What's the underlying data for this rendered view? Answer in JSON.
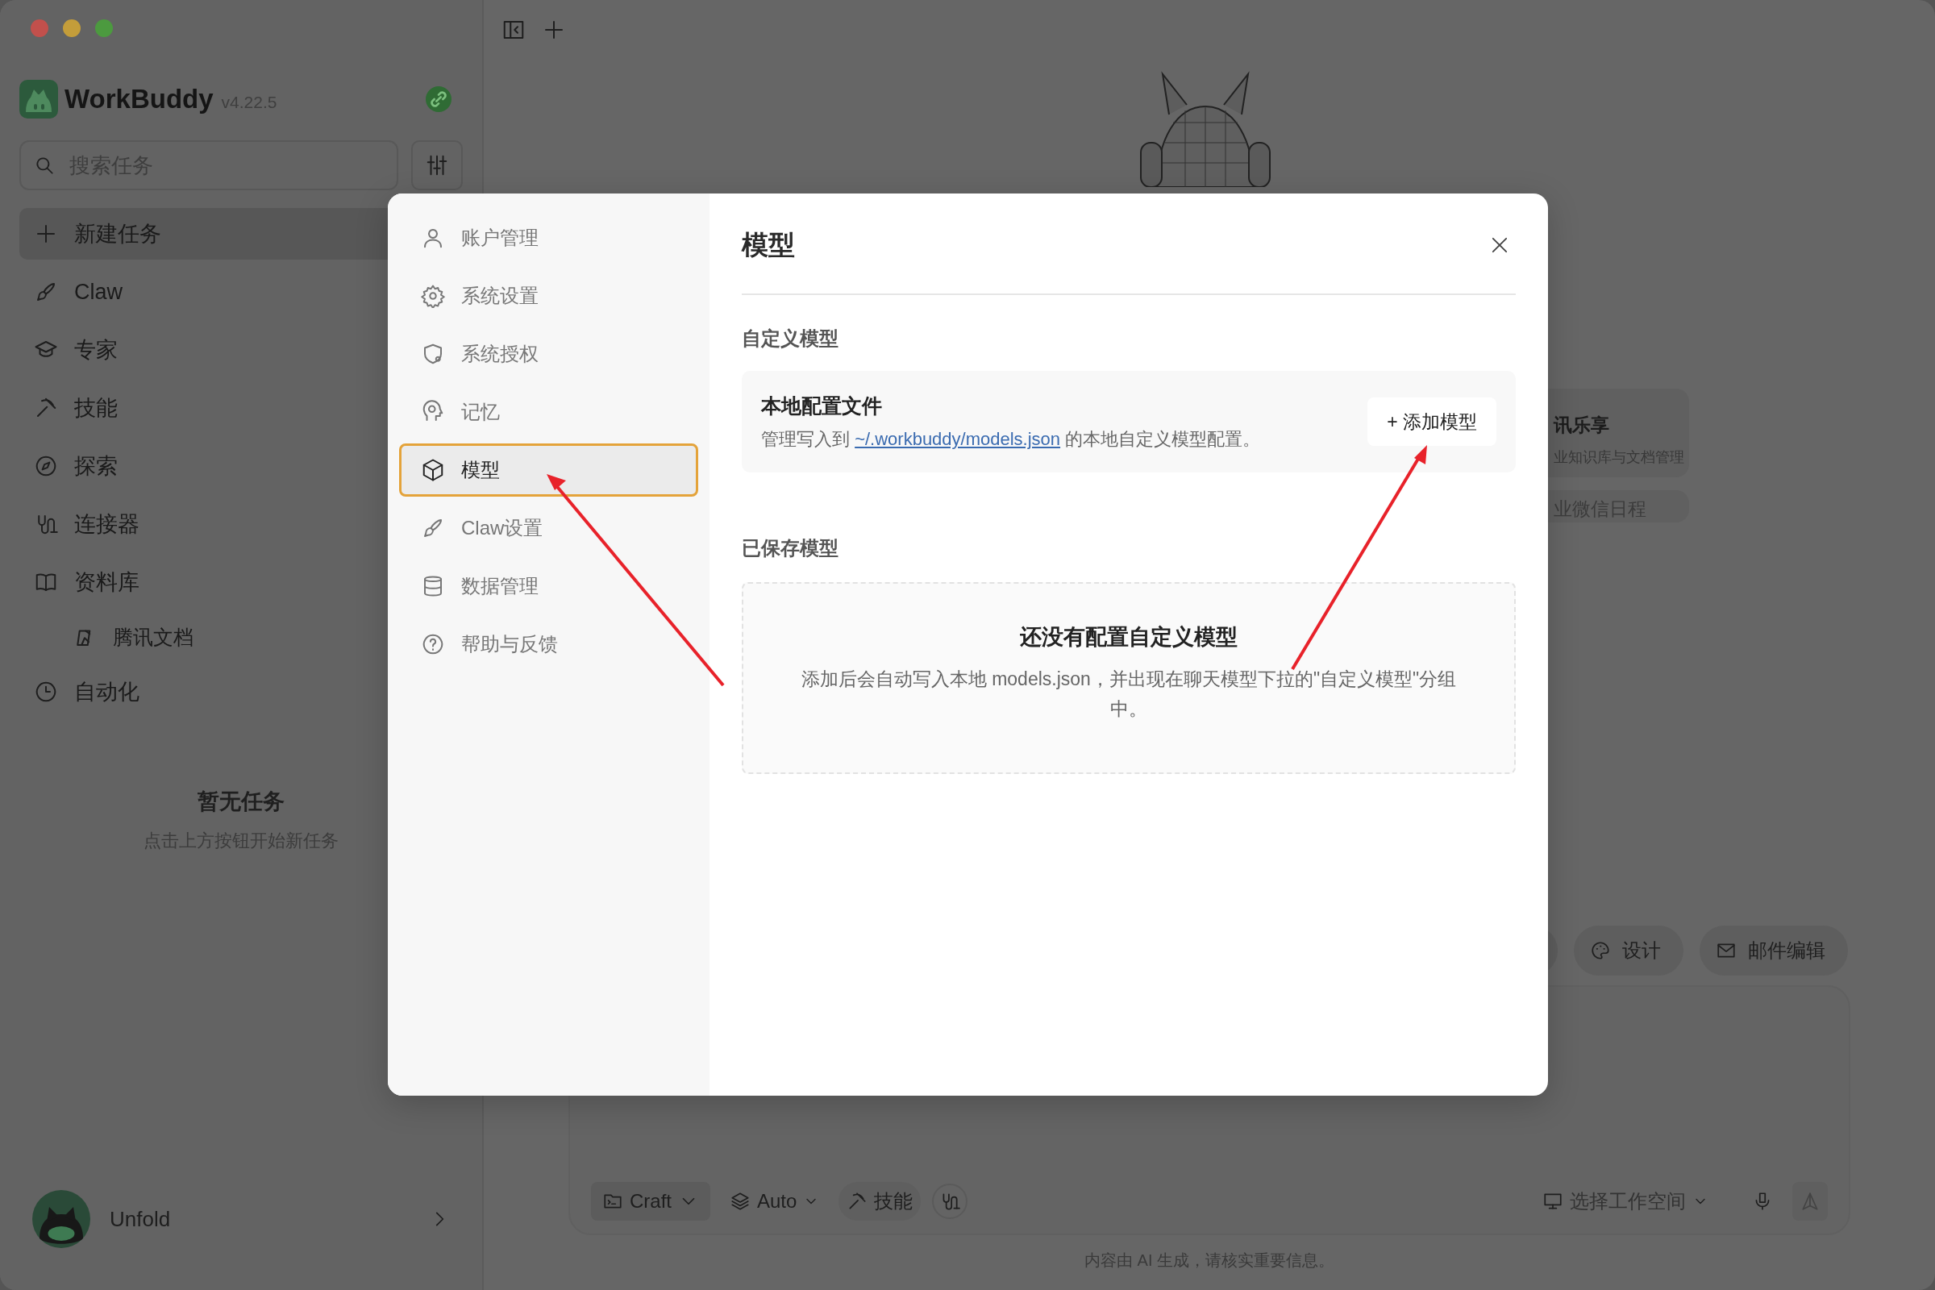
{
  "app": {
    "name": "WorkBuddy",
    "version": "v4.22.5"
  },
  "sidebar": {
    "search": {
      "placeholder": "搜索任务"
    },
    "items": [
      {
        "label": "新建任务",
        "selected": true
      },
      {
        "label": "Claw",
        "selected": false
      },
      {
        "label": "专家",
        "selected": false
      },
      {
        "label": "技能",
        "selected": false
      },
      {
        "label": "探索",
        "selected": false
      },
      {
        "label": "连接器",
        "selected": false
      },
      {
        "label": "资料库",
        "selected": false,
        "children": [
          {
            "label": "腾讯文档",
            "selected": false
          }
        ]
      },
      {
        "label": "自动化",
        "selected": false
      }
    ],
    "empty": {
      "title": "暂无任务",
      "hint": "点击上方按钮开始新任务"
    },
    "user": {
      "name": "Unfold"
    }
  },
  "main": {
    "quick_cards": [
      {
        "title": "讯乐享",
        "subtitle": "业知识库与文档管理"
      },
      {
        "title": "业微信日程"
      }
    ],
    "chips": [
      "设计",
      "邮件编辑"
    ],
    "composer": {
      "mode": "Craft",
      "model": "Auto",
      "skills": "技能",
      "workspace": "选择工作空间"
    },
    "disclaimer": "内容由 AI 生成，请核实重要信息。"
  },
  "dialog": {
    "nav": [
      {
        "label": "账户管理",
        "selected": false
      },
      {
        "label": "系统设置",
        "selected": false
      },
      {
        "label": "系统授权",
        "selected": false
      },
      {
        "label": "记忆",
        "selected": false
      },
      {
        "label": "模型",
        "selected": true
      },
      {
        "label": "Claw设置",
        "selected": false
      },
      {
        "label": "数据管理",
        "selected": false
      },
      {
        "label": "帮助与反馈",
        "selected": false
      }
    ],
    "title": "模型",
    "custom": {
      "heading": "自定义模型",
      "card_title": "本地配置文件",
      "description_before": "管理写入到",
      "link": "~/.workbuddy/models.json",
      "description_after": "的本地自定义模型配置。",
      "add_button": "+ 添加模型"
    },
    "saved": {
      "heading": "已保存模型",
      "empty_title": "还没有配置自定义模型",
      "empty_hint": "添加后会自动写入本地 models.json，并出现在聊天模型下拉的\"自定义模型\"分组中。"
    }
  }
}
